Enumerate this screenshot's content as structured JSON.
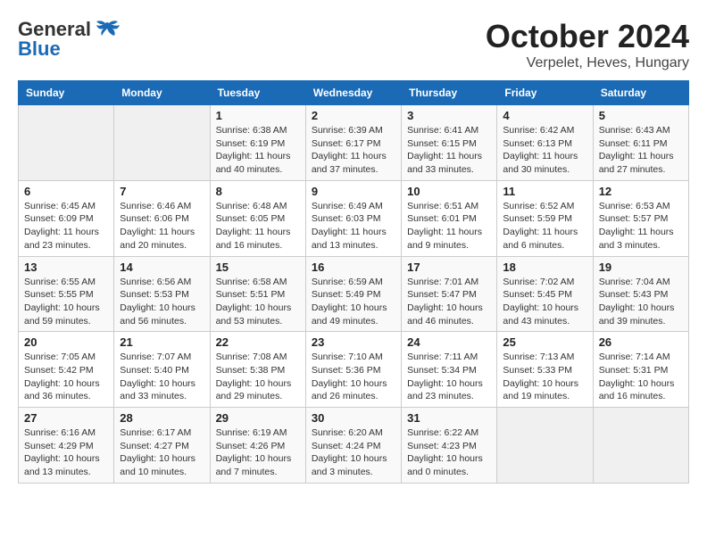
{
  "logo": {
    "general": "General",
    "blue": "Blue"
  },
  "title": "October 2024",
  "location": "Verpelet, Heves, Hungary",
  "weekdays": [
    "Sunday",
    "Monday",
    "Tuesday",
    "Wednesday",
    "Thursday",
    "Friday",
    "Saturday"
  ],
  "weeks": [
    [
      {
        "day": "",
        "info": ""
      },
      {
        "day": "",
        "info": ""
      },
      {
        "day": "1",
        "info": "Sunrise: 6:38 AM\nSunset: 6:19 PM\nDaylight: 11 hours and 40 minutes."
      },
      {
        "day": "2",
        "info": "Sunrise: 6:39 AM\nSunset: 6:17 PM\nDaylight: 11 hours and 37 minutes."
      },
      {
        "day": "3",
        "info": "Sunrise: 6:41 AM\nSunset: 6:15 PM\nDaylight: 11 hours and 33 minutes."
      },
      {
        "day": "4",
        "info": "Sunrise: 6:42 AM\nSunset: 6:13 PM\nDaylight: 11 hours and 30 minutes."
      },
      {
        "day": "5",
        "info": "Sunrise: 6:43 AM\nSunset: 6:11 PM\nDaylight: 11 hours and 27 minutes."
      }
    ],
    [
      {
        "day": "6",
        "info": "Sunrise: 6:45 AM\nSunset: 6:09 PM\nDaylight: 11 hours and 23 minutes."
      },
      {
        "day": "7",
        "info": "Sunrise: 6:46 AM\nSunset: 6:06 PM\nDaylight: 11 hours and 20 minutes."
      },
      {
        "day": "8",
        "info": "Sunrise: 6:48 AM\nSunset: 6:05 PM\nDaylight: 11 hours and 16 minutes."
      },
      {
        "day": "9",
        "info": "Sunrise: 6:49 AM\nSunset: 6:03 PM\nDaylight: 11 hours and 13 minutes."
      },
      {
        "day": "10",
        "info": "Sunrise: 6:51 AM\nSunset: 6:01 PM\nDaylight: 11 hours and 9 minutes."
      },
      {
        "day": "11",
        "info": "Sunrise: 6:52 AM\nSunset: 5:59 PM\nDaylight: 11 hours and 6 minutes."
      },
      {
        "day": "12",
        "info": "Sunrise: 6:53 AM\nSunset: 5:57 PM\nDaylight: 11 hours and 3 minutes."
      }
    ],
    [
      {
        "day": "13",
        "info": "Sunrise: 6:55 AM\nSunset: 5:55 PM\nDaylight: 10 hours and 59 minutes."
      },
      {
        "day": "14",
        "info": "Sunrise: 6:56 AM\nSunset: 5:53 PM\nDaylight: 10 hours and 56 minutes."
      },
      {
        "day": "15",
        "info": "Sunrise: 6:58 AM\nSunset: 5:51 PM\nDaylight: 10 hours and 53 minutes."
      },
      {
        "day": "16",
        "info": "Sunrise: 6:59 AM\nSunset: 5:49 PM\nDaylight: 10 hours and 49 minutes."
      },
      {
        "day": "17",
        "info": "Sunrise: 7:01 AM\nSunset: 5:47 PM\nDaylight: 10 hours and 46 minutes."
      },
      {
        "day": "18",
        "info": "Sunrise: 7:02 AM\nSunset: 5:45 PM\nDaylight: 10 hours and 43 minutes."
      },
      {
        "day": "19",
        "info": "Sunrise: 7:04 AM\nSunset: 5:43 PM\nDaylight: 10 hours and 39 minutes."
      }
    ],
    [
      {
        "day": "20",
        "info": "Sunrise: 7:05 AM\nSunset: 5:42 PM\nDaylight: 10 hours and 36 minutes."
      },
      {
        "day": "21",
        "info": "Sunrise: 7:07 AM\nSunset: 5:40 PM\nDaylight: 10 hours and 33 minutes."
      },
      {
        "day": "22",
        "info": "Sunrise: 7:08 AM\nSunset: 5:38 PM\nDaylight: 10 hours and 29 minutes."
      },
      {
        "day": "23",
        "info": "Sunrise: 7:10 AM\nSunset: 5:36 PM\nDaylight: 10 hours and 26 minutes."
      },
      {
        "day": "24",
        "info": "Sunrise: 7:11 AM\nSunset: 5:34 PM\nDaylight: 10 hours and 23 minutes."
      },
      {
        "day": "25",
        "info": "Sunrise: 7:13 AM\nSunset: 5:33 PM\nDaylight: 10 hours and 19 minutes."
      },
      {
        "day": "26",
        "info": "Sunrise: 7:14 AM\nSunset: 5:31 PM\nDaylight: 10 hours and 16 minutes."
      }
    ],
    [
      {
        "day": "27",
        "info": "Sunrise: 6:16 AM\nSunset: 4:29 PM\nDaylight: 10 hours and 13 minutes."
      },
      {
        "day": "28",
        "info": "Sunrise: 6:17 AM\nSunset: 4:27 PM\nDaylight: 10 hours and 10 minutes."
      },
      {
        "day": "29",
        "info": "Sunrise: 6:19 AM\nSunset: 4:26 PM\nDaylight: 10 hours and 7 minutes."
      },
      {
        "day": "30",
        "info": "Sunrise: 6:20 AM\nSunset: 4:24 PM\nDaylight: 10 hours and 3 minutes."
      },
      {
        "day": "31",
        "info": "Sunrise: 6:22 AM\nSunset: 4:23 PM\nDaylight: 10 hours and 0 minutes."
      },
      {
        "day": "",
        "info": ""
      },
      {
        "day": "",
        "info": ""
      }
    ]
  ]
}
